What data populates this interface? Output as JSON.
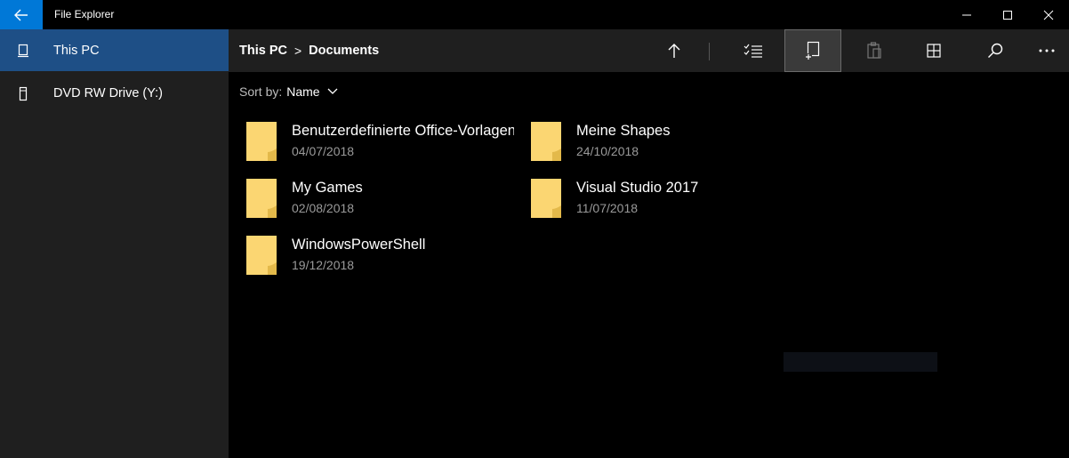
{
  "window": {
    "title": "File Explorer"
  },
  "sidebar": {
    "items": [
      {
        "label": "This PC",
        "icon": "computer-icon"
      },
      {
        "label": "DVD RW Drive (Y:)",
        "icon": "drive-icon"
      }
    ]
  },
  "breadcrumb": {
    "root": "This PC",
    "separator": ">",
    "current": "Documents"
  },
  "sort": {
    "label": "Sort by:",
    "value": "Name"
  },
  "files": [
    {
      "name": "Benutzerdefinierte Office-Vorlagen",
      "date": "04/07/2018"
    },
    {
      "name": "Meine Shapes",
      "date": "24/10/2018"
    },
    {
      "name": "My Games",
      "date": "02/08/2018"
    },
    {
      "name": "Visual Studio 2017",
      "date": "11/07/2018"
    },
    {
      "name": "WindowsPowerShell",
      "date": "19/12/2018"
    }
  ],
  "colors": {
    "accent": "#0078d7",
    "sidebar_selected": "#1e4f86",
    "folder": "#fbd672",
    "background": "#000000",
    "panel": "#1f1f1f"
  }
}
